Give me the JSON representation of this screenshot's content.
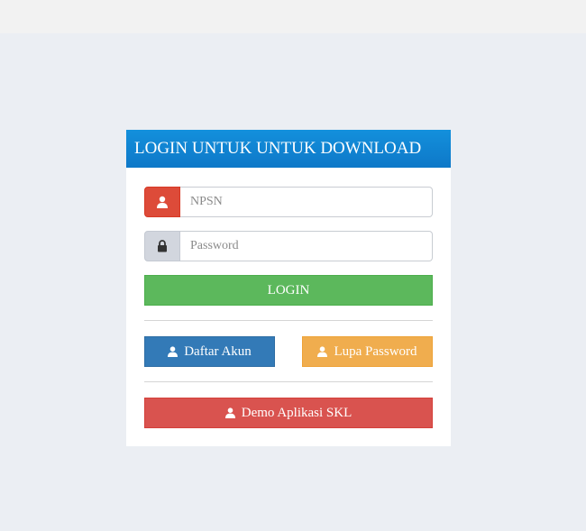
{
  "header": {
    "title": "LOGIN UNTUK UNTUK DOWNLOAD"
  },
  "form": {
    "npsn_placeholder": "NPSN",
    "password_placeholder": "Password",
    "login_label": "LOGIN",
    "daftar_label": "Daftar Akun",
    "lupa_label": "Lupa Password",
    "demo_label": "Demo Aplikasi SKL"
  },
  "icons": {
    "npsn": "user-icon",
    "password": "lock-icon",
    "daftar": "user-icon",
    "lupa": "user-icon",
    "demo": "user-icon"
  },
  "colors": {
    "header": "#0e78c8",
    "login": "#5cb85c",
    "daftar": "#337ab7",
    "lupa": "#f0ad4e",
    "demo": "#d9534f",
    "npsn_addon": "#dd4b39",
    "password_addon": "#d2d6de"
  }
}
